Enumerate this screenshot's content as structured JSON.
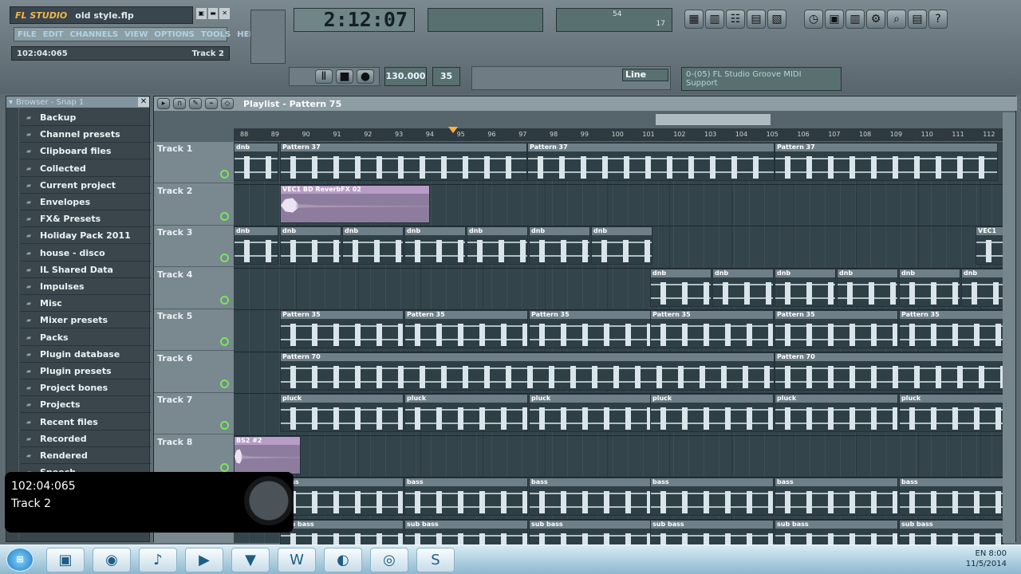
{
  "app": {
    "logo": "FL STUDIO",
    "filename": "old style.flp",
    "position": "102:04:065",
    "track": "Track 2",
    "time": "2:12:07"
  },
  "menu": [
    "FILE",
    "EDIT",
    "CHANNELS",
    "VIEW",
    "OPTIONS",
    "TOOLS",
    "HELP"
  ],
  "top": {
    "line": "Line",
    "module": "0-(05) FL Studio Groove MIDI\nSupport",
    "tempo": "130.000",
    "pattern": "35",
    "cpu": "54",
    "poly": "17"
  },
  "browser": {
    "title": "Browser - Snap 1",
    "items": [
      "Backup",
      "Channel presets",
      "Clipboard files",
      "Collected",
      "Current project",
      "Envelopes",
      "FX& Presets",
      "Holiday Pack 2011",
      "house - disco",
      "IL Shared Data",
      "Impulses",
      "Misc",
      "Mixer presets",
      "Packs",
      "Plugin database",
      "Plugin presets",
      "Project bones",
      "Projects",
      "Recent files",
      "Recorded",
      "Rendered",
      "Speech"
    ]
  },
  "playlist": {
    "title": "Playlist - Pattern 75",
    "ruler": [
      "88",
      "89",
      "90",
      "91",
      "92",
      "93",
      "94",
      "95",
      "96",
      "97",
      "98",
      "99",
      "100",
      "101",
      "102",
      "103",
      "104",
      "105",
      "106",
      "107",
      "108",
      "109",
      "110",
      "111",
      "112"
    ],
    "tracks": [
      "Track 1",
      "Track 2",
      "Track 3",
      "Track 4",
      "Track 5",
      "Track 6",
      "Track 7",
      "Track 8"
    ],
    "clips": [
      "dnb",
      "Pattern 37",
      "VEC1 BD ReverbFX 02",
      "Pattern 35",
      "Pattern 70",
      "pluck",
      "bass",
      "sub bass",
      "BS2 #2",
      "VEC1"
    ]
  },
  "overlay": {
    "position": "102:04:065",
    "track": "Track 2"
  },
  "taskbar": {
    "lang": "EN",
    "time": "8:00",
    "date": "11/5/2014",
    "apps": [
      "folder",
      "chrome",
      "fl-studio",
      "media-player",
      "app",
      "word",
      "firefox",
      "quicktime",
      "skype"
    ]
  }
}
